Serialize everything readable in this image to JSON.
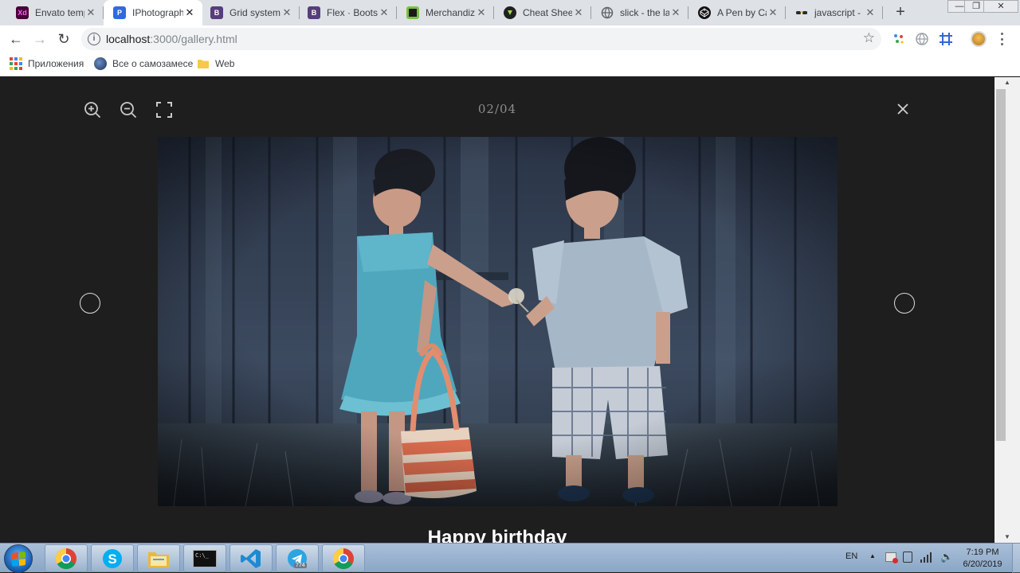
{
  "browser": {
    "tabs": [
      {
        "title": "Envato temp",
        "favicon": "xd-icon",
        "fav_text": "Xd",
        "fav_color": "#470137",
        "active": false
      },
      {
        "title": "IPhotograph",
        "favicon": "photograph-icon",
        "fav_text": "P",
        "fav_color": "#2f6bdc",
        "active": true
      },
      {
        "title": "Grid system",
        "favicon": "bootstrap-icon",
        "fav_text": "B",
        "fav_color": "#563d7c",
        "active": false
      },
      {
        "title": "Flex · Bootst",
        "favicon": "bootstrap-icon",
        "fav_text": "B",
        "fav_color": "#563d7c",
        "active": false
      },
      {
        "title": "Merchandiz",
        "favicon": "merchandise-icon",
        "fav_text": "",
        "fav_color": "#4c9a2a",
        "active": false
      },
      {
        "title": "Cheat Sheet",
        "favicon": "cheatsheet-icon",
        "fav_text": "",
        "fav_color": "#202020",
        "active": false
      },
      {
        "title": "slick - the la",
        "favicon": "globe-icon",
        "fav_text": "",
        "fav_color": "#5f6368",
        "active": false
      },
      {
        "title": "A Pen by Ca",
        "favicon": "codepen-icon",
        "fav_text": "",
        "fav_color": "#111111",
        "active": false
      },
      {
        "title": "javascript - I",
        "favicon": "sunglasses-icon",
        "fav_text": "",
        "fav_color": "#e3a600",
        "active": false
      }
    ],
    "tab_close_glyph": "✕",
    "new_tab_glyph": "+",
    "window_controls": {
      "minimize": "—",
      "maximize": "❐",
      "close": "✕"
    },
    "nav": {
      "back": "←",
      "forward": "→",
      "reload": "↻"
    },
    "url_host": "localhost",
    "url_path": ":3000/gallery.html",
    "bookmark_star": "☆",
    "bookmarks": [
      {
        "label": "Приложения",
        "icon": "apps-grid-icon"
      },
      {
        "label": "Все о самозамесе",
        "icon": "site-icon"
      },
      {
        "label": "Web",
        "icon": "folder-icon"
      }
    ]
  },
  "gallery": {
    "counter": "02/04",
    "caption": "Happy birthday",
    "toolbar_icons": [
      "zoom-in-icon",
      "zoom-out-icon",
      "fullscreen-icon"
    ],
    "close_icon": "close-icon",
    "prev_icon": "prev-arrow-circle",
    "next_icon": "next-arrow-circle"
  },
  "scrollbar": {
    "up": "▲",
    "down": "▼"
  },
  "taskbar": {
    "apps": [
      "chrome-icon",
      "skype-icon",
      "explorer-icon",
      "cmd-icon",
      "vscode-icon",
      "telegram-icon",
      "chrome-icon"
    ],
    "telegram_badge": "774",
    "cmd_text": "C:\\_",
    "lang": "EN",
    "time": "7:19 PM",
    "date": "6/20/2019"
  },
  "colors": {
    "tabstrip": "#dee1e6",
    "gallery_bg": "#1e1e1e",
    "counter": "#8d8d8d",
    "caption": "#ffffff"
  }
}
